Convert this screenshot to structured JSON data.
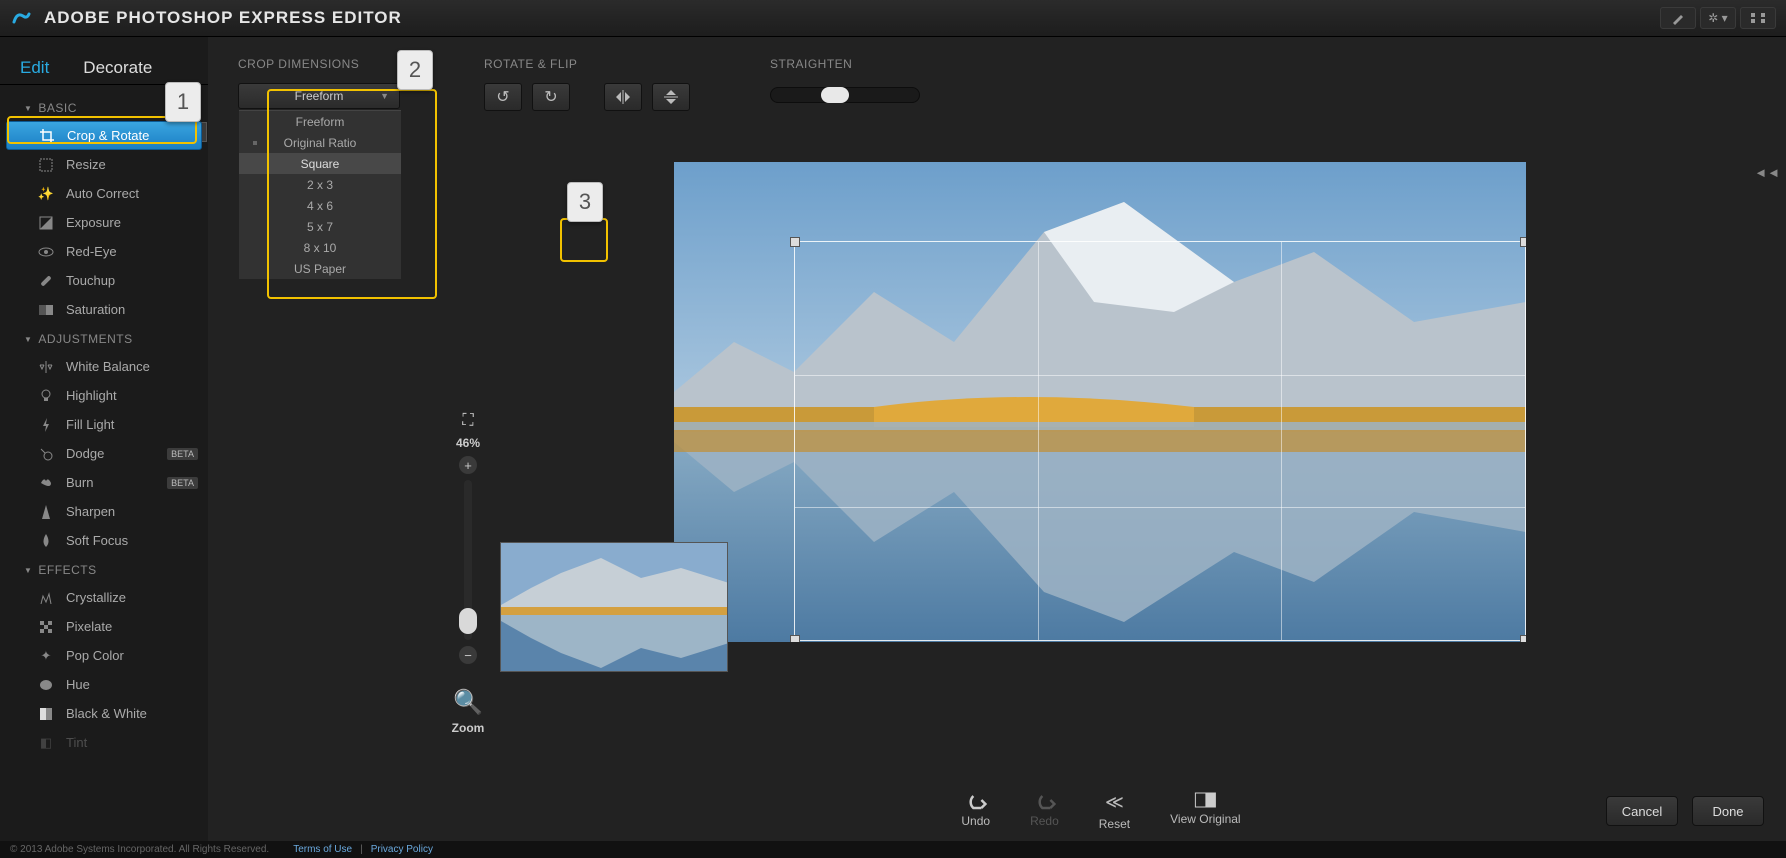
{
  "app": {
    "title": "ADOBE PHOTOSHOP EXPRESS EDITOR"
  },
  "side_tabs": {
    "edit": "Edit",
    "decorate": "Decorate"
  },
  "groups": {
    "basic": {
      "label": "BASIC",
      "items": [
        "Crop & Rotate",
        "Resize",
        "Auto Correct",
        "Exposure",
        "Red-Eye",
        "Touchup",
        "Saturation"
      ]
    },
    "adjustments": {
      "label": "ADJUSTMENTS",
      "items": [
        "White Balance",
        "Highlight",
        "Fill Light",
        "Dodge",
        "Burn",
        "Sharpen",
        "Soft Focus"
      ],
      "beta": {
        "3": "BETA",
        "4": "BETA"
      }
    },
    "effects": {
      "label": "EFFECTS",
      "items": [
        "Crystallize",
        "Pixelate",
        "Pop Color",
        "Hue",
        "Black & White",
        "Tint"
      ]
    }
  },
  "toolbar": {
    "crop_label": "CROP DIMENSIONS",
    "rotate_label": "ROTATE & FLIP",
    "straighten_label": "STRAIGHTEN",
    "dropdown_selected": "Freeform",
    "dropdown_items": [
      "Freeform",
      "Original Ratio",
      "Square",
      "2 x 3",
      "4 x 6",
      "5 x 7",
      "8 x 10",
      "US Paper"
    ],
    "dropdown_hover_index": 2,
    "dropdown_marked_index": 1
  },
  "zoom": {
    "pct": "46%",
    "label": "Zoom"
  },
  "ops": {
    "undo": "Undo",
    "redo": "Redo",
    "reset": "Reset",
    "view_original": "View Original",
    "cancel": "Cancel",
    "done": "Done"
  },
  "footer": {
    "copyright": "© 2013 Adobe Systems Incorporated. All Rights Reserved.",
    "terms": "Terms of Use",
    "sep": "|",
    "privacy": "Privacy Policy"
  },
  "badges": {
    "b1": "1",
    "b2": "2",
    "b3": "3"
  }
}
